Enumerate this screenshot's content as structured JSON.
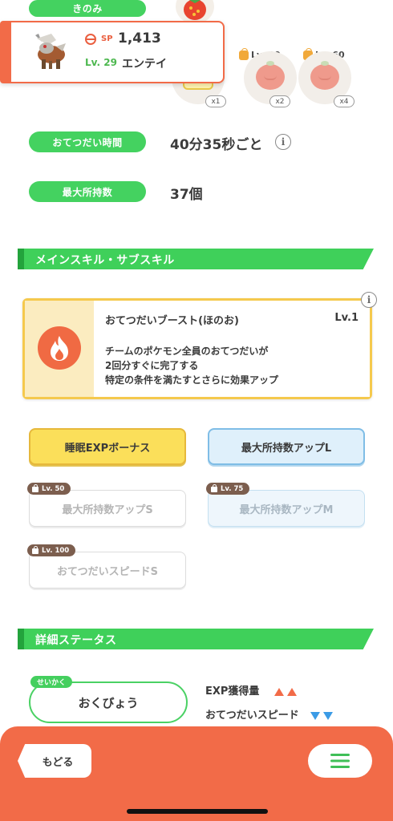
{
  "berry": {
    "label": "きのみ",
    "unlocks": [
      {
        "level": "Lv. 30",
        "multiplier": "x2"
      },
      {
        "level": "Lv. 60",
        "multiplier": "x4"
      }
    ],
    "current_multiplier": "x1"
  },
  "pokemon": {
    "sp_label": "SP",
    "sp_value": "1,413",
    "level": "Lv. 29",
    "name": "エンテイ"
  },
  "help_time": {
    "label": "おてつだい時間",
    "value": "40分35秒ごと"
  },
  "max_carry": {
    "label": "最大所持数",
    "value": "37個"
  },
  "skills_section": {
    "title": "メインスキル・サブスキル"
  },
  "main_skill": {
    "name": "おてつだいブースト(ほのお)",
    "level": "Lv.1",
    "description": [
      "チームのポケモン全員のおてつだいが",
      "2回分すぐに完了する",
      "特定の条件を満たすとさらに効果アップ"
    ]
  },
  "sub_skills": [
    {
      "label": "睡眠EXPボーナス",
      "lock": ""
    },
    {
      "label": "最大所持数アップL",
      "lock": ""
    },
    {
      "label": "最大所持数アップS",
      "lock": "Lv. 50"
    },
    {
      "label": "最大所持数アップM",
      "lock": "Lv. 75"
    },
    {
      "label": "おてつだいスピードS",
      "lock": "Lv. 100"
    }
  ],
  "detail_section": {
    "title": "詳細ステータス"
  },
  "nature": {
    "chip": "せいかく",
    "value": "おくびょう",
    "up_label": "EXP獲得量",
    "down_label": "おてつだいスピード"
  },
  "nav": {
    "back_label": "もどる",
    "menu_icon": "hamburger-menu-icon"
  },
  "colors": {
    "accent_green": "#44d260",
    "accent_orange": "#f26b48",
    "gold": "#fbdf5a",
    "blue": "#dff0fb"
  }
}
